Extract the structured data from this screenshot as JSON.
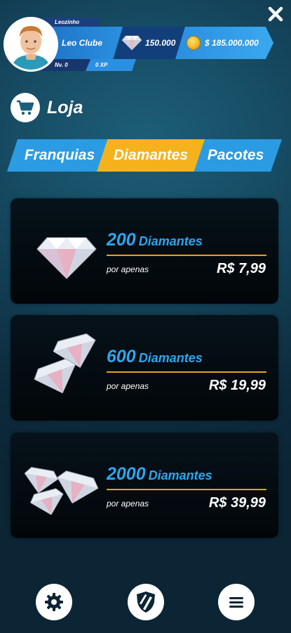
{
  "header": {
    "player_name": "Leozinho",
    "club_name": "Leo Clube",
    "level": "Nv. 0",
    "xp": "0 XP",
    "diamonds": "150.000",
    "money": "$ 185.000.000"
  },
  "page": {
    "title": "Loja"
  },
  "tabs": [
    {
      "label": "Franquias",
      "active": false
    },
    {
      "label": "Diamantes",
      "active": true
    },
    {
      "label": "Pacotes",
      "active": false
    }
  ],
  "products": [
    {
      "amount": "200",
      "unit": "Diamantes",
      "caption": "por apenas",
      "price": "R$ 7,99"
    },
    {
      "amount": "600",
      "unit": "Diamantes",
      "caption": "por apenas",
      "price": "R$ 19,99"
    },
    {
      "amount": "2000",
      "unit": "Diamantes",
      "caption": "por apenas",
      "price": "R$ 39,99"
    }
  ],
  "icons": {
    "close": "close-icon",
    "cart": "cart-icon",
    "diamond": "diamond-icon",
    "coin": "coin-icon",
    "settings": "gear-icon",
    "club": "shield-icon",
    "menu": "menu-icon"
  },
  "colors": {
    "tab_active": "#f6b21c",
    "tab_inactive": "#2b9be3",
    "accent_blue": "#2ca6ee",
    "divider": "#e3a21a"
  }
}
